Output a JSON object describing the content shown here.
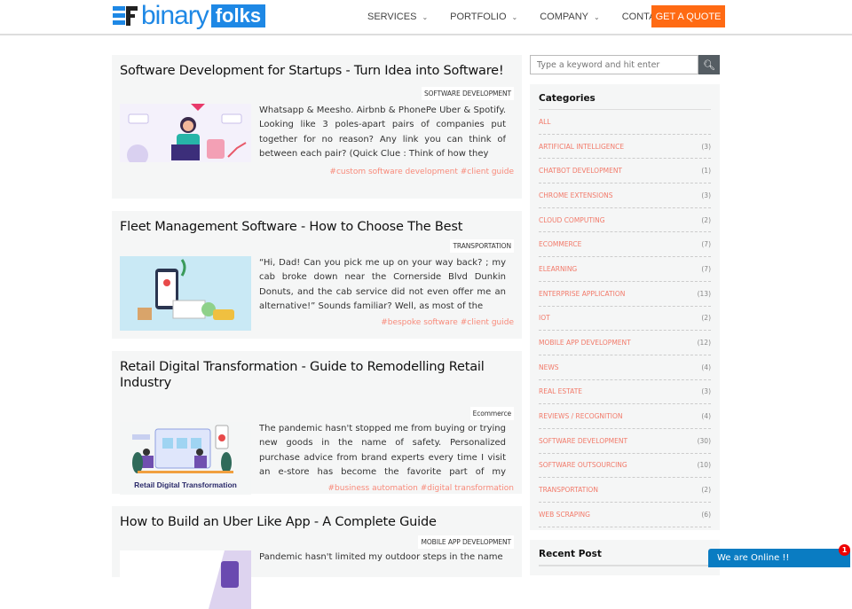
{
  "header": {
    "logo_text": "binary",
    "logo_box": "folks",
    "nav": [
      {
        "label": "SERVICES",
        "dropdown": true
      },
      {
        "label": "PORTFOLIO",
        "dropdown": true
      },
      {
        "label": "COMPANY",
        "dropdown": true
      },
      {
        "label": "CONTACT US",
        "dropdown": false
      }
    ],
    "cta": "GET A QUOTE"
  },
  "posts": [
    {
      "title": "Software Development for Startups - Turn Idea into Software!",
      "tag": "SOFTWARE DEVELOPMENT",
      "excerpt": "Whatsapp & Meesho. Airbnb & PhonePe Uber & Spotify. Looking like 3 poles-apart pairs of companies put together for no reason? Any link you can think of between each pair? (Quick Clue : Think of how they",
      "hashtags": "#custom software development #client guide"
    },
    {
      "title": "Fleet Management Software - How to Choose The Best",
      "tag": "TRANSPORTATION",
      "excerpt": "“Hi, Dad! Can you pick me up on your way back? ; my cab broke down near the Cornerside Blvd Dunkin Donuts, and the cab service did not even offer me an alternative!” Sounds familiar? Well, as most of the",
      "hashtags": "#bespoke software #client guide"
    },
    {
      "title": "Retail Digital Transformation - Guide to Remodelling Retail Industry",
      "tag": "Ecommerce",
      "excerpt": "The pandemic hasn't stopped me from buying or trying new goods in the name of safety. Personalized purchase advice from brand experts every time I visit an e-store has become the favorite part of my purchase process",
      "hashtags": "#business automation #digital transformation",
      "image_caption": "Retail Digital Transformation"
    },
    {
      "title": "How to Build an Uber Like App - A Complete Guide",
      "tag": "MOBILE APP DEVELOPMENT",
      "excerpt": "Pandemic hasn't limited my outdoor steps in the name",
      "hashtags": ""
    }
  ],
  "search": {
    "placeholder": "Type a keyword and hit enter"
  },
  "categories": {
    "title": "Categories",
    "items": [
      {
        "name": "ALL",
        "count": ""
      },
      {
        "name": "ARTIFICIAL INTELLIGENCE",
        "count": "(3)"
      },
      {
        "name": "CHATBOT DEVELOPMENT",
        "count": "(1)"
      },
      {
        "name": "CHROME EXTENSIONS",
        "count": "(3)"
      },
      {
        "name": "CLOUD COMPUTING",
        "count": "(2)"
      },
      {
        "name": "ECOMMERCE",
        "count": "(7)"
      },
      {
        "name": "ELEARNING",
        "count": "(7)"
      },
      {
        "name": "ENTERPRISE APPLICATION",
        "count": "(13)"
      },
      {
        "name": "IOT",
        "count": "(2)"
      },
      {
        "name": "MOBILE APP DEVELOPMENT",
        "count": "(12)"
      },
      {
        "name": "NEWS",
        "count": "(4)"
      },
      {
        "name": "REAL ESTATE",
        "count": "(3)"
      },
      {
        "name": "REVIEWS / RECOGNITION",
        "count": "(4)"
      },
      {
        "name": "SOFTWARE DEVELOPMENT",
        "count": "(30)"
      },
      {
        "name": "SOFTWARE OUTSOURCING",
        "count": "(10)"
      },
      {
        "name": "TRANSPORTATION",
        "count": "(2)"
      },
      {
        "name": "WEB SCRAPING",
        "count": "(6)"
      }
    ]
  },
  "recent": {
    "title": "Recent Post"
  },
  "chat": {
    "label": "We are Online !!",
    "badge": "1"
  }
}
